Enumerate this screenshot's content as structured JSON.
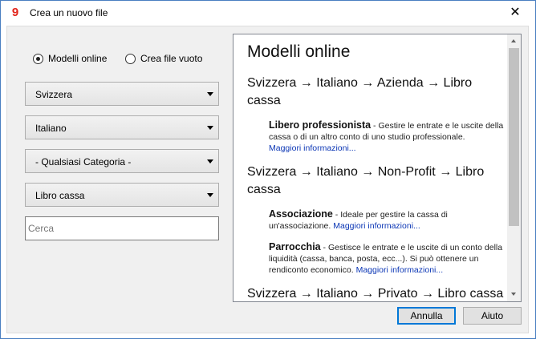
{
  "window": {
    "title": "Crea un nuovo file",
    "close_glyph": "✕",
    "app_icon": "gnucash-9-icon"
  },
  "source_options": [
    {
      "label": "Modelli online",
      "checked": true
    },
    {
      "label": "Crea file vuoto",
      "checked": false
    }
  ],
  "filters": {
    "country": "Svizzera",
    "language": "Italiano",
    "category": "- Qualsiasi Categoria -",
    "type": "Libro cassa"
  },
  "search": {
    "placeholder": "Cerca",
    "value": ""
  },
  "templates": {
    "heading": "Modelli online",
    "groups": [
      {
        "path": "Svizzera → Italiano → Azienda → Libro cassa",
        "items": [
          {
            "title": "Libero professionista",
            "description": " - Gestire le entrate e le uscite della cassa o di un altro conto di uno studio professionale.",
            "link": "Maggiori informazioni..."
          }
        ]
      },
      {
        "path": "Svizzera → Italiano → Non-Profit → Libro cassa",
        "items": [
          {
            "title": "Associazione",
            "description": " - Ideale per gestire la cassa di un'associazione.",
            "link": "Maggiori informazioni..."
          },
          {
            "title": "Parrocchia",
            "description": " - Gestisce le entrate e le uscite di un conto della liquidità (cassa, banca, posta, ecc...). Si può ottenere un rendiconto economico.",
            "link": "Maggiori informazioni..."
          }
        ]
      },
      {
        "path": "Svizzera → Italiano → Privato → Libro cassa",
        "items": []
      }
    ]
  },
  "buttons": {
    "cancel": "Annulla",
    "help": "Aiuto"
  },
  "colors": {
    "link": "#0b36b5",
    "accent": "#0078d7",
    "app_icon_red": "#e2231a"
  }
}
